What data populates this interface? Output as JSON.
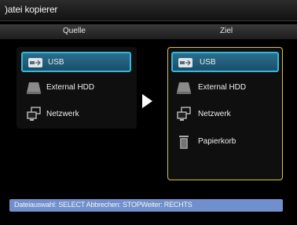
{
  "title": ")atei kopierer",
  "columns": {
    "source": "Quelle",
    "target": "Ziel"
  },
  "source_items": [
    {
      "label": "USB",
      "icon": "usb-icon",
      "selected": true
    },
    {
      "label": "External HDD",
      "icon": "hdd-icon",
      "selected": false
    },
    {
      "label": "Netzwerk",
      "icon": "network-icon",
      "selected": false
    }
  ],
  "target_items": [
    {
      "label": "USB",
      "icon": "usb-icon",
      "selected": true
    },
    {
      "label": "External HDD",
      "icon": "hdd-icon",
      "selected": false
    },
    {
      "label": "Netzwerk",
      "icon": "network-icon",
      "selected": false
    },
    {
      "label": "Papierkorb",
      "icon": "trash-icon",
      "selected": false
    }
  ],
  "status": "Dateiauswahl: SELECT Abbrechen: STOPWeiter: RECHTS",
  "colors": {
    "selection": "#2a6e8e",
    "selection_border": "#38b6d8",
    "target_border": "#d4c43a",
    "status_bg": "#6f8fcd"
  }
}
